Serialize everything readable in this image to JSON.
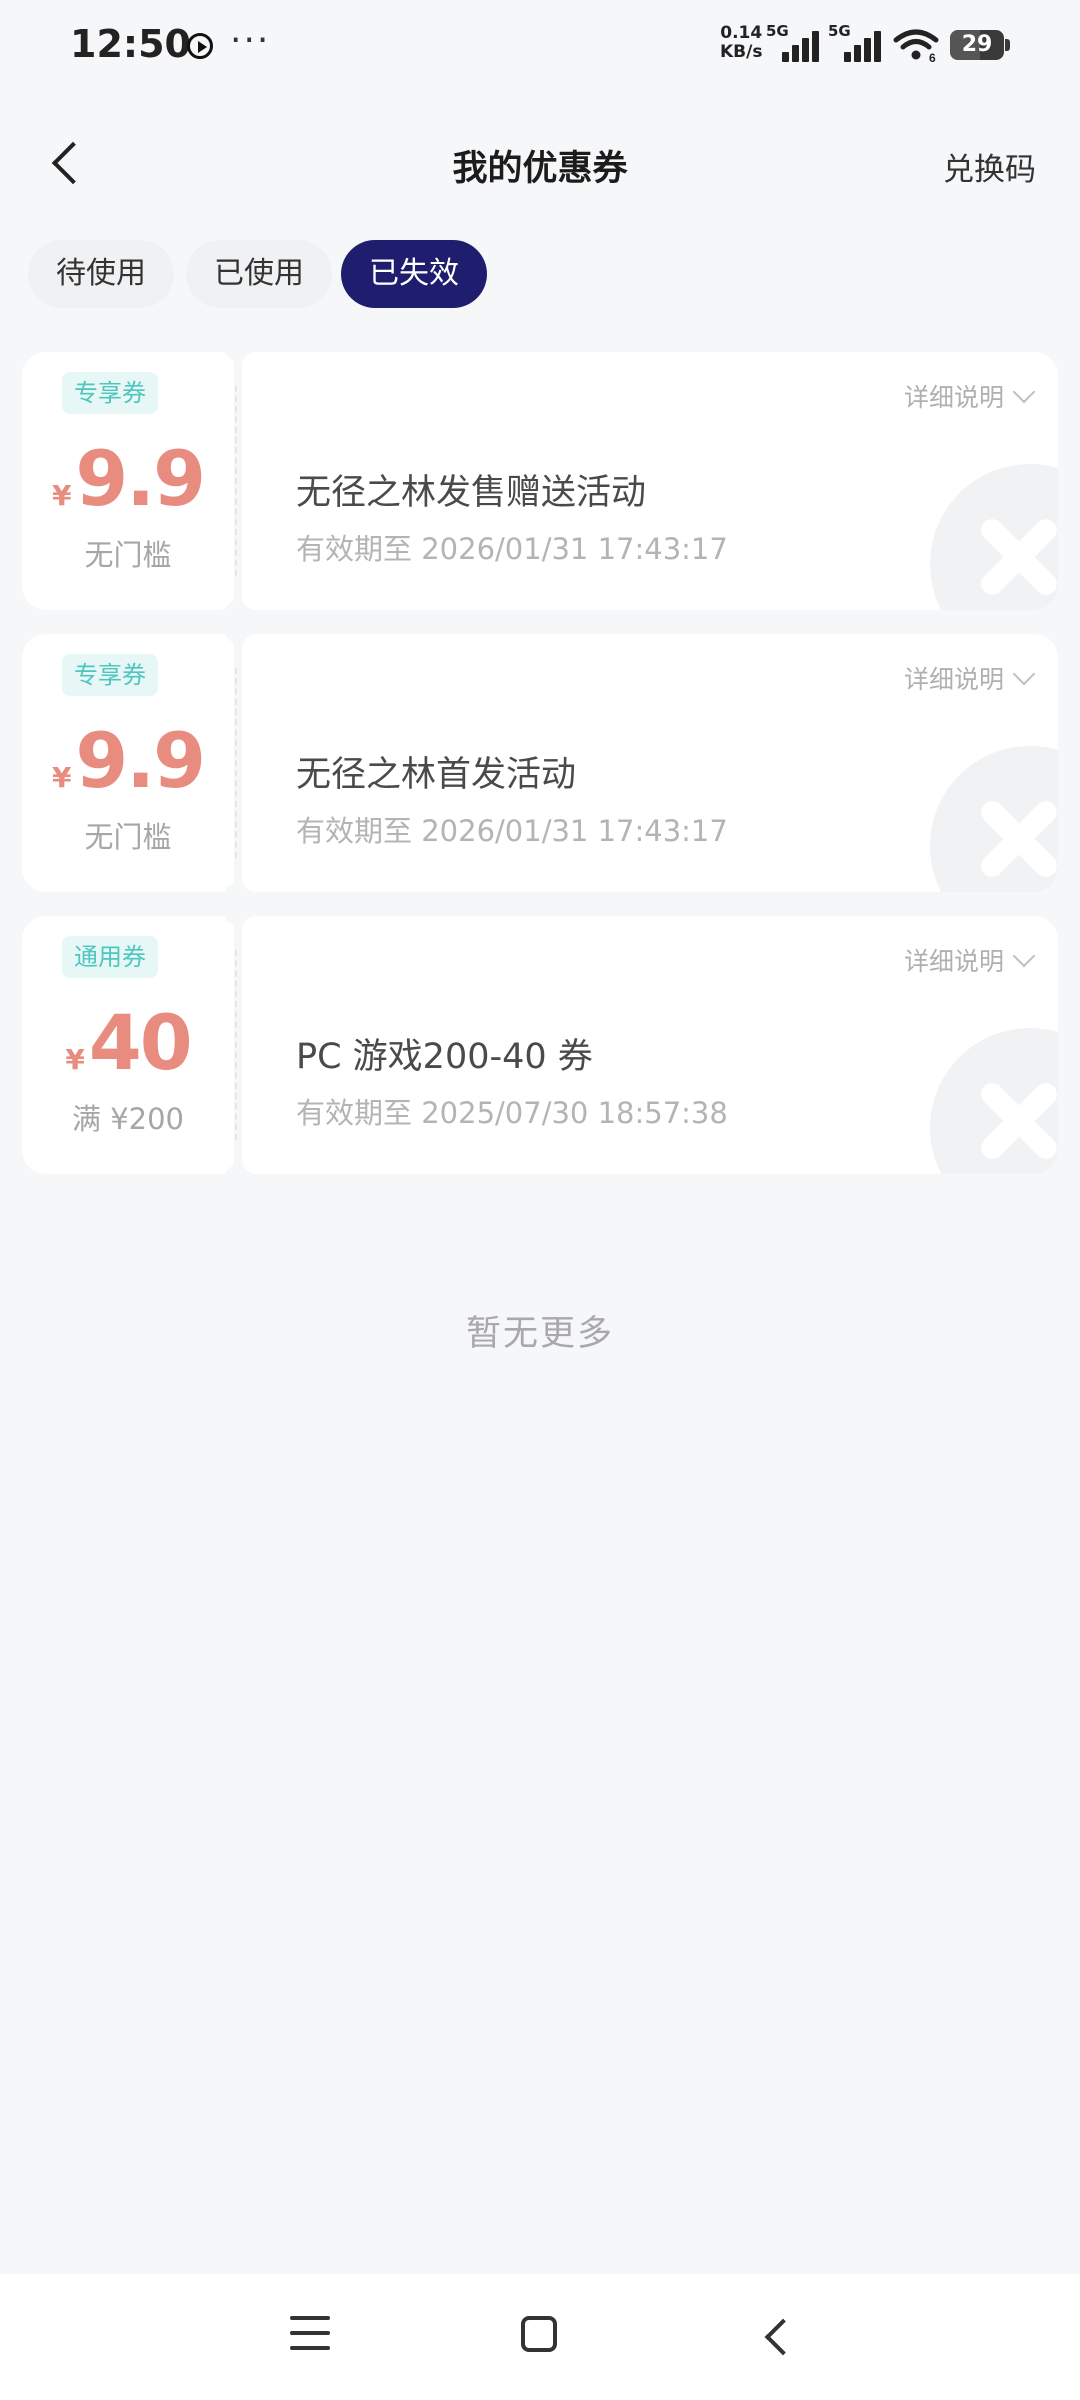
{
  "status_bar": {
    "time": "12:50",
    "more": "···",
    "net_speed_value": "0.14",
    "net_speed_unit": "KB/s",
    "sim1": "5G",
    "sim2": "5G",
    "wifi_sub": "6",
    "battery": "29"
  },
  "header": {
    "title": "我的优惠券",
    "redeem_label": "兑换码"
  },
  "tabs": [
    {
      "label": "待使用",
      "active": false
    },
    {
      "label": "已使用",
      "active": false
    },
    {
      "label": "已失效",
      "active": true
    }
  ],
  "coupons": [
    {
      "badge": "专享券",
      "currency": "¥",
      "amount": "9.9",
      "condition": "无门槛",
      "title": "无径之林发售赠送活动",
      "expire": "有效期至 2026/01/31 17:43:17",
      "detail": "详细说明"
    },
    {
      "badge": "专享券",
      "currency": "¥",
      "amount": "9.9",
      "condition": "无门槛",
      "title": "无径之林首发活动",
      "expire": "有效期至 2026/01/31 17:43:17",
      "detail": "详细说明"
    },
    {
      "badge": "通用券",
      "currency": "¥",
      "amount": "40",
      "condition": "满 ¥200",
      "title": "PC 游戏200-40 券",
      "expire": "有效期至 2025/07/30 18:57:38",
      "detail": "详细说明"
    }
  ],
  "footer_text": "暂无更多",
  "colors": {
    "accent_tab": "#1f1e6e",
    "price": "#e88c80",
    "badge_text": "#4fc5bf",
    "background": "#f6f7f9"
  }
}
